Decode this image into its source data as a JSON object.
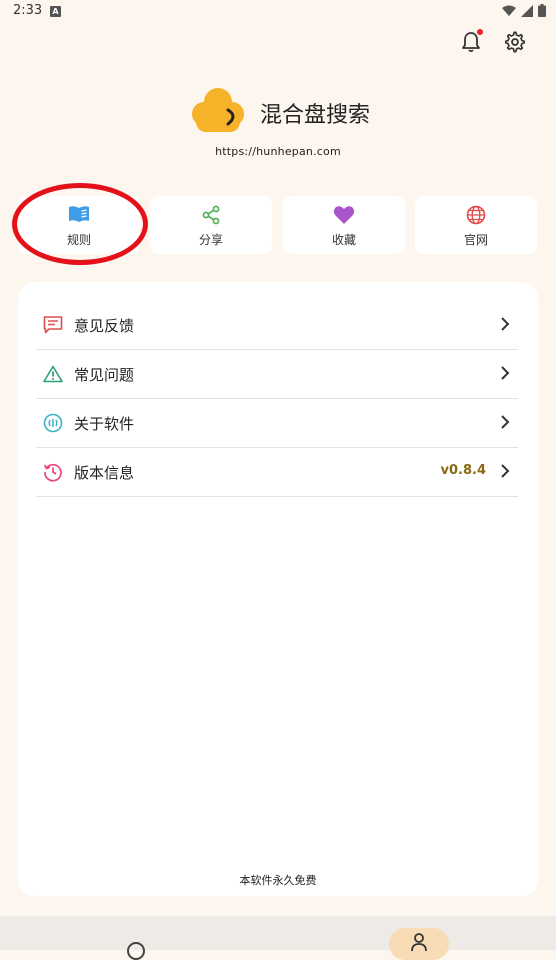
{
  "status_bar": {
    "time": "2:33",
    "notification_letter": "A"
  },
  "header": {
    "bell_icon": "bell-icon",
    "settings_icon": "gear-icon",
    "has_notification": true
  },
  "app": {
    "name": "混合盘搜索",
    "url": "https://hunhepan.com",
    "logo_color": "#f6b32a"
  },
  "quick_actions": [
    {
      "label": "规则",
      "icon": "book-icon",
      "color": "#3e9de6"
    },
    {
      "label": "分享",
      "icon": "share-icon",
      "color": "#4caf50"
    },
    {
      "label": "收藏",
      "icon": "heart-icon",
      "color": "#a755c9"
    },
    {
      "label": "官网",
      "icon": "globe-icon",
      "color": "#e44b4b"
    }
  ],
  "menu": [
    {
      "label": "意见反馈",
      "icon": "feedback-icon",
      "color": "#e04f4f"
    },
    {
      "label": "常见问题",
      "icon": "warning-icon",
      "color": "#2e9e7e"
    },
    {
      "label": "关于软件",
      "icon": "about-icon",
      "color": "#3bb3c6"
    },
    {
      "label": "版本信息",
      "icon": "history-icon",
      "color": "#e8457a",
      "value": "v0.8.4"
    }
  ],
  "footer_note": "本软件永久免费",
  "colors": {
    "background": "#fdf6ee",
    "highlight": "#e4101a",
    "version_text": "#8a6a10",
    "nav_active": "#f7dcb6"
  }
}
